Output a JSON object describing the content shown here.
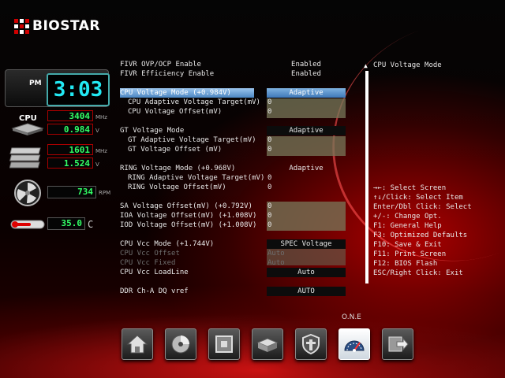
{
  "brand": {
    "name": "BIOSTAR"
  },
  "monitor": {
    "clock": {
      "period": "PM",
      "time": "3:03"
    },
    "cpu": {
      "label": "CPU",
      "freq": "3404",
      "freq_unit": "MHz",
      "volt": "0.984",
      "volt_unit": "V"
    },
    "memory": {
      "freq": "1601",
      "freq_unit": "MHz",
      "volt": "1.524",
      "volt_unit": "V"
    },
    "fan": {
      "speed": "734",
      "unit": "RPM"
    },
    "temp": {
      "value": "35.0",
      "unit": "C"
    }
  },
  "settings": [
    {
      "label": "FIVR OVP/OCP Enable",
      "value": "Enabled"
    },
    {
      "label": "FIVR Efficiency Enable",
      "value": "Enabled"
    },
    {
      "label": "CPU Voltage Mode (+0.984V)",
      "value": "Adaptive"
    },
    {
      "label": "CPU Adaptive Voltage Target(mV)",
      "value": "0"
    },
    {
      "label": "CPU Voltage Offset(mV)",
      "value": "0"
    },
    {
      "label": "GT Voltage Mode",
      "value": "Adaptive"
    },
    {
      "label": "GT Adaptive Voltage Target(mV)",
      "value": "0"
    },
    {
      "label": "GT Voltage Offset (mV)",
      "value": "0"
    },
    {
      "label": "RING Voltage Mode (+0.968V)",
      "value": "Adaptive"
    },
    {
      "label": "RING Adaptive Voltage Target(mV)",
      "value": "0"
    },
    {
      "label": "RING Voltage Offset(mV)",
      "value": "0"
    },
    {
      "label": "SA Voltage Offset(mV) (+0.792V)",
      "value": "0"
    },
    {
      "label": "IOA Voltage Offset(mV) (+1.008V)",
      "value": "0"
    },
    {
      "label": "IOD Voltage Offset(mV) (+1.008V)",
      "value": "0"
    },
    {
      "label": "CPU Vcc Mode (+1.744V)",
      "value": "SPEC Voltage"
    },
    {
      "label": "CPU Vcc Offset",
      "value": "Auto"
    },
    {
      "label": "CPU Vcc Fixed",
      "value": "Auto"
    },
    {
      "label": "CPU Vcc LoadLine",
      "value": "Auto"
    },
    {
      "label": "DDR Ch-A DQ vref",
      "value": "AUTO"
    }
  ],
  "help": {
    "title": "CPU Voltage Mode",
    "keys": [
      "→←: Select Screen",
      "↑↓/Click: Select Item",
      "Enter/Dbl Click: Select",
      "+/-: Change Opt.",
      "F1: General Help",
      "F3: Optimized Defaults",
      "F10: Save & Exit",
      "F11: Print Screen",
      "F12: BIOS Flash",
      "ESC/Right Click: Exit"
    ]
  },
  "dock": {
    "active_label": "O.N.E",
    "items": [
      "home-icon",
      "disc-icon",
      "chip-icon",
      "drive-icon",
      "shield-icon",
      "gauge-icon",
      "exit-icon"
    ]
  },
  "colors": {
    "accent_red": "#d00000",
    "clock_cyan": "#22e8f2",
    "lcd_green": "#33ff66",
    "select_blue": "#4b86c2"
  }
}
